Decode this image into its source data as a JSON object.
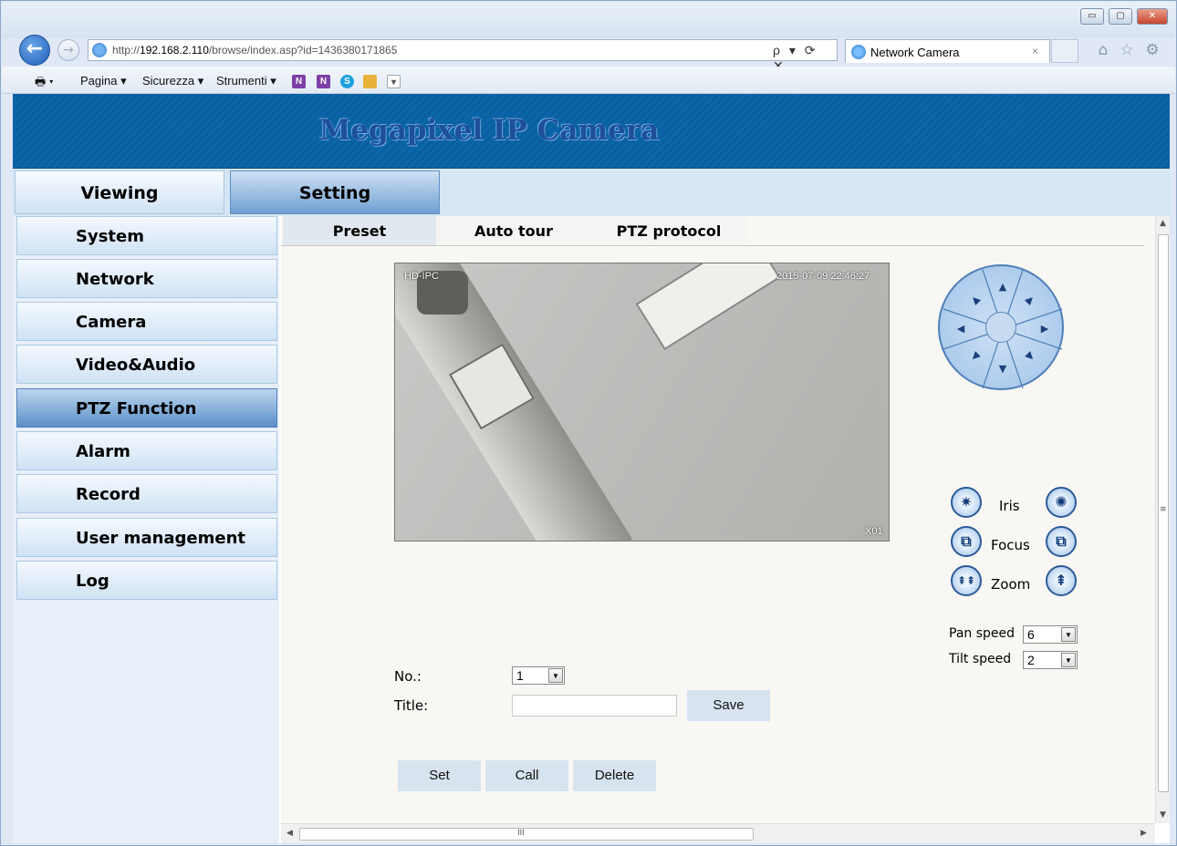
{
  "browser": {
    "address_prefix": "http://",
    "address_host": "192.168.2.110",
    "address_path": "/browse/index.asp?id=1436380171865",
    "address_controls": "ρ ▾ ⟳ ✕",
    "tab_title": "Network Camera",
    "tab_close": "×",
    "window_buttons": [
      "▭",
      "▢",
      "✕"
    ],
    "toolbar_icons": [
      "home-icon",
      "star-icon",
      "gear-icon"
    ],
    "command_bar": {
      "pagina": "Pagina ▾",
      "sicurezza": "Sicurezza ▾",
      "strumenti": "Strumenti ▾"
    }
  },
  "banner": {
    "title": "Megapixel IP Camera"
  },
  "top_nav": {
    "viewing": "Viewing",
    "setting": "Setting"
  },
  "sidebar": {
    "items": [
      {
        "label": "System",
        "active": false
      },
      {
        "label": "Network",
        "active": false
      },
      {
        "label": "Camera",
        "active": false
      },
      {
        "label": "Video&Audio",
        "active": false
      },
      {
        "label": "PTZ Function",
        "active": true
      },
      {
        "label": "Alarm",
        "active": false
      },
      {
        "label": "Record",
        "active": false
      },
      {
        "label": "User management",
        "active": false
      },
      {
        "label": "Log",
        "active": false
      }
    ]
  },
  "subtabs": {
    "preset": "Preset",
    "auto_tour": "Auto tour",
    "ptz_protocol": "PTZ protocol"
  },
  "video": {
    "osd_left": "HD-IPC",
    "osd_time": "2015-07-09  22:46:27",
    "osd_channel": "X01"
  },
  "ptz": {
    "iris": "Iris",
    "focus": "Focus",
    "zoom": "Zoom",
    "pan_speed_label": "Pan speed",
    "pan_speed": "6",
    "tilt_speed_label": "Tilt speed",
    "tilt_speed": "2"
  },
  "preset_form": {
    "no_label": "No.:",
    "no_value": "1",
    "title_label": "Title:",
    "title_value": "",
    "save": "Save",
    "set": "Set",
    "call": "Call",
    "delete": "Delete"
  },
  "scrollbar": {
    "h_grip": "III",
    "v_grip": "≡"
  },
  "colors": {
    "banner": "#0b63a6",
    "active_nav": "#5c8fc8",
    "button": "#d7e3ef"
  }
}
